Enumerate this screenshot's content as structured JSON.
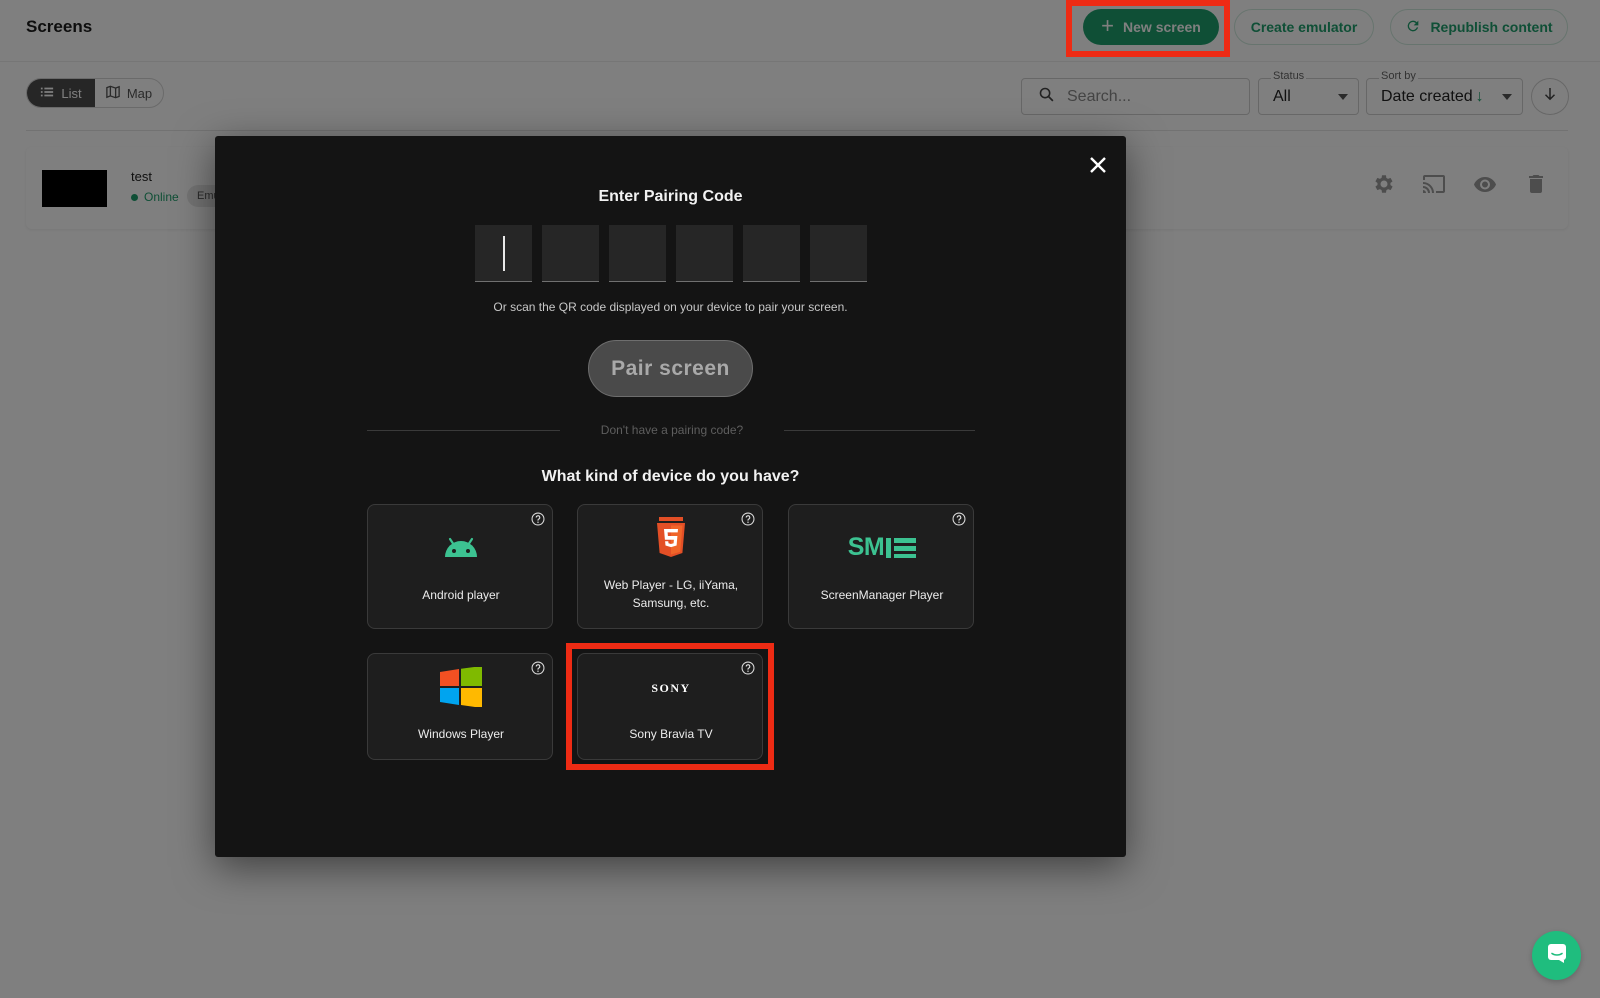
{
  "header": {
    "title": "Screens",
    "new_screen_label": "New screen",
    "create_emulator_label": "Create emulator",
    "republish_label": "Republish content"
  },
  "view_toggle": {
    "list_label": "List",
    "map_label": "Map",
    "active": "List"
  },
  "filters": {
    "search_placeholder": "Search...",
    "status_label": "Status",
    "status_value": "All",
    "sort_label": "Sort by",
    "sort_value": "Date created"
  },
  "screens": [
    {
      "name": "test",
      "status": "Online",
      "badge": "Emu"
    }
  ],
  "modal": {
    "title": "Enter Pairing Code",
    "code_values": [
      "",
      "",
      "",
      "",
      "",
      ""
    ],
    "qr_hint": "Or scan the QR code displayed on your device to pair your screen.",
    "pair_button": "Pair screen",
    "separator_text": "Don't have a pairing code?",
    "device_question": "What kind of device do you have?",
    "devices": [
      {
        "label": "Android player",
        "icon": "android-icon"
      },
      {
        "label_line1": "Web Player - LG, iiYama,",
        "label_line2": "Samsung, etc.",
        "icon": "html5-icon"
      },
      {
        "label": "ScreenManager Player",
        "icon": "screenmanager-logo",
        "logo_text": "SM"
      },
      {
        "label": "Windows Player",
        "icon": "windows-icon"
      },
      {
        "label": "Sony Bravia TV",
        "icon": "sony-logo",
        "logo_text": "SONY"
      }
    ]
  },
  "colors": {
    "brand_green": "#1f9e6c",
    "highlight_red": "#ee2b14",
    "modal_bg": "#141414",
    "sm_green": "#3cc291"
  }
}
